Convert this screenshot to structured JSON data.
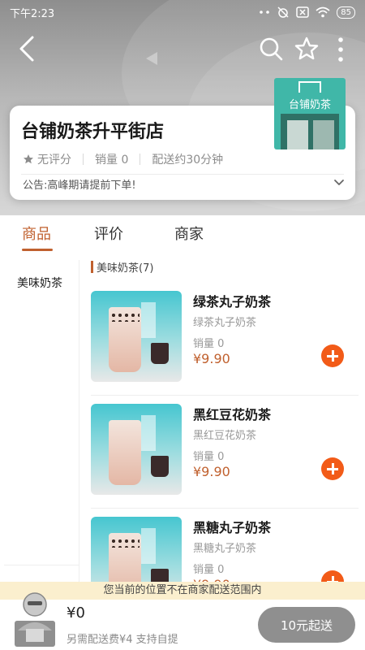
{
  "status_bar": {
    "time": "下午2:23",
    "battery": "85"
  },
  "shop": {
    "logo_text": "台铺奶茶",
    "name": "台铺奶茶升平街店",
    "rating": "无评分",
    "sales": "销量 0",
    "delivery": "配送约30分钟",
    "notice": "公告:高峰期请提前下单!"
  },
  "tabs": [
    {
      "label": "商品",
      "active": true
    },
    {
      "label": "评价",
      "active": false
    },
    {
      "label": "商家",
      "active": false
    }
  ],
  "categories": [
    {
      "label": "美味奶茶"
    }
  ],
  "section": {
    "title": "美味奶茶(7)"
  },
  "products": [
    {
      "name": "绿茶丸子奶茶",
      "desc": "绿茶丸子奶茶",
      "sales": "销量 0",
      "price": "¥9.90"
    },
    {
      "name": "黑红豆花奶茶",
      "desc": "黑红豆花奶茶",
      "sales": "销量 0",
      "price": "¥9.90"
    },
    {
      "name": "黑糖丸子奶茶",
      "desc": "黑糖丸子奶茶",
      "sales": "销量 0",
      "price": "¥9.90"
    }
  ],
  "warning": "您当前的位置不在商家配送范围内",
  "cart": {
    "amount": "¥0",
    "fee_note": "另需配送费¥4  支持自提",
    "min_order_button": "10元起送"
  },
  "colors": {
    "accent": "#c0602e",
    "add_button": "#f25b18",
    "logo_bg": "#40b7a8"
  }
}
